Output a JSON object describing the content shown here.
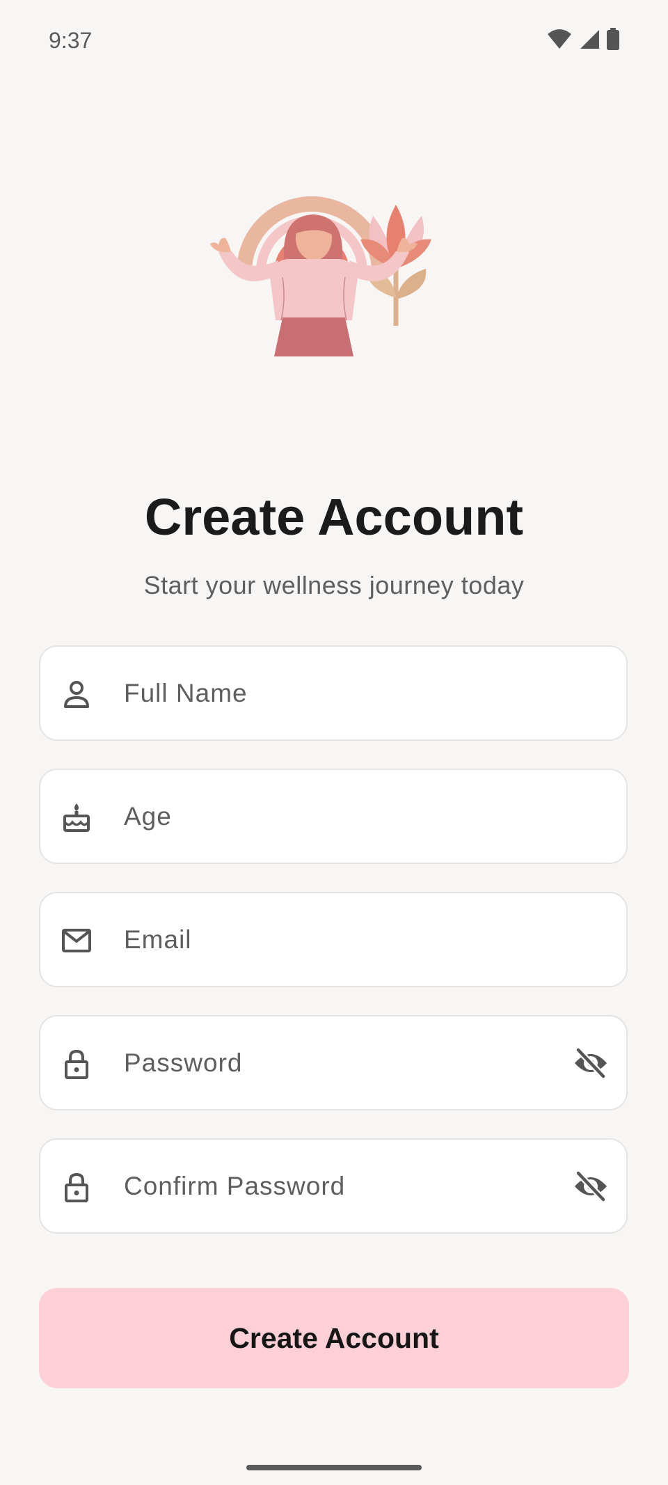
{
  "status_bar": {
    "time": "9:37",
    "icons": [
      "wifi-icon",
      "signal-icon",
      "battery-icon"
    ]
  },
  "hero": {
    "illustration": "woman-with-rainbow-and-flower-illustration"
  },
  "header": {
    "title": "Create Account",
    "subtitle": "Start your wellness journey today"
  },
  "form": {
    "fields": [
      {
        "placeholder": "Full Name",
        "icon": "person-icon"
      },
      {
        "placeholder": "Age",
        "icon": "cake-icon"
      },
      {
        "placeholder": "Email",
        "icon": "mail-icon"
      },
      {
        "placeholder": "Password",
        "icon": "lock-icon",
        "trailing_icon": "visibility-off-icon"
      },
      {
        "placeholder": "Confirm Password",
        "icon": "lock-icon",
        "trailing_icon": "visibility-off-icon"
      }
    ],
    "submit_label": "Create Account"
  },
  "colors": {
    "background": "#f7f6f5",
    "field_background": "#ffffff",
    "field_border": "#e6e4e2",
    "button_background": "#fdd0d8",
    "title_text": "#1b1b1b",
    "secondary_text": "#5e5e5e"
  }
}
